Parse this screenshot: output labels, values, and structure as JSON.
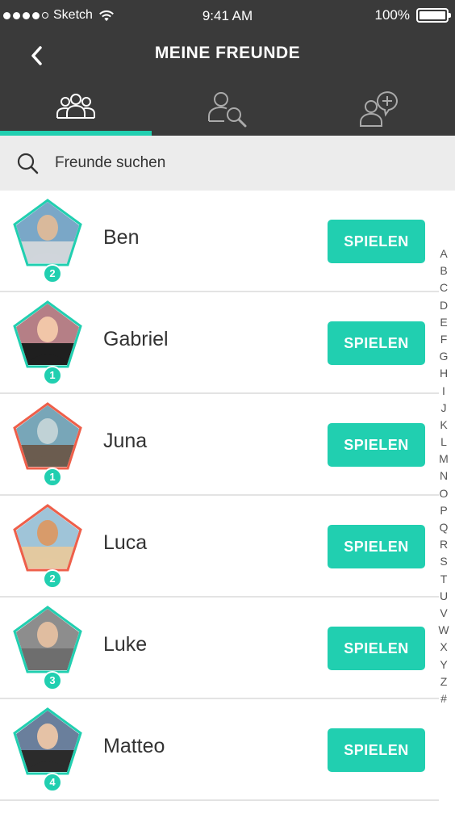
{
  "status_bar": {
    "carrier": "Sketch",
    "time": "9:41 AM",
    "battery": "100%"
  },
  "header": {
    "title": "MEINE FREUNDE",
    "back_icon": "chevron-left-icon"
  },
  "tabs": [
    {
      "icon": "friends-group-icon",
      "active": true
    },
    {
      "icon": "user-search-icon",
      "active": false
    },
    {
      "icon": "user-add-chat-icon",
      "active": false
    }
  ],
  "search": {
    "placeholder": "Freunde suchen"
  },
  "colors": {
    "accent": "#21cfb0",
    "header_bg": "#3a3a3a",
    "frame_teal": "#21cfb0",
    "frame_coral": "#ee5f4a"
  },
  "friends": [
    {
      "name": "Ben",
      "badge": "2",
      "frame": "teal",
      "button": "SPIELEN"
    },
    {
      "name": "Gabriel",
      "badge": "1",
      "frame": "teal",
      "button": "SPIELEN"
    },
    {
      "name": "Juna",
      "badge": "1",
      "frame": "coral",
      "button": "SPIELEN"
    },
    {
      "name": "Luca",
      "badge": "2",
      "frame": "coral",
      "button": "SPIELEN"
    },
    {
      "name": "Luke",
      "badge": "3",
      "frame": "teal",
      "button": "SPIELEN"
    },
    {
      "name": "Matteo",
      "badge": "4",
      "frame": "teal",
      "button": "SPIELEN"
    }
  ],
  "alphabet": [
    "A",
    "B",
    "C",
    "D",
    "E",
    "F",
    "G",
    "H",
    "I",
    "J",
    "K",
    "L",
    "M",
    "N",
    "O",
    "P",
    "Q",
    "R",
    "S",
    "T",
    "U",
    "V",
    "W",
    "X",
    "Y",
    "Z",
    "#"
  ]
}
